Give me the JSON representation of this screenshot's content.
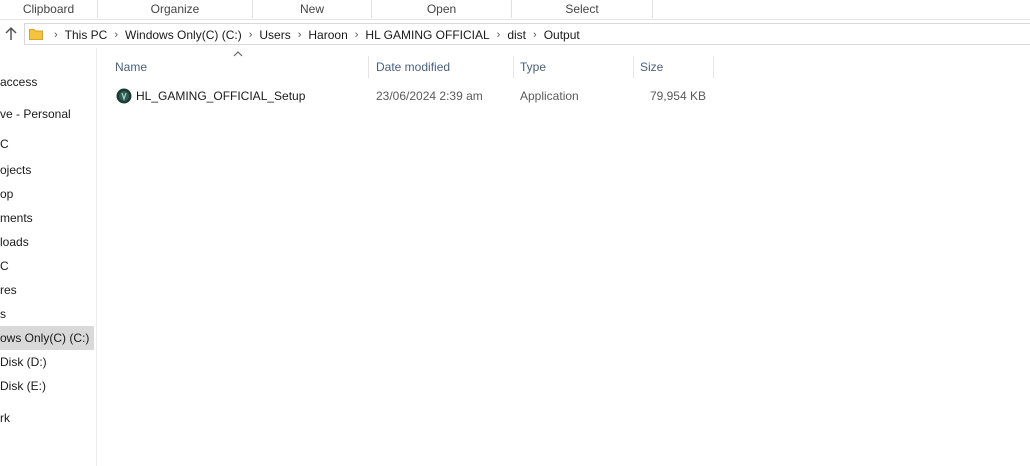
{
  "ribbon": {
    "groups": [
      "Clipboard",
      "Organize",
      "New",
      "Open",
      "Select"
    ]
  },
  "address": {
    "breadcrumbs": [
      "This PC",
      "Windows Only(C) (C:)",
      "Users",
      "Haroon",
      "HL GAMING OFFICIAL",
      "dist",
      "Output"
    ]
  },
  "nav": {
    "items": [
      {
        "label": "access"
      },
      {
        "label": "ve - Personal"
      },
      {
        "label": "C"
      },
      {
        "label": "ojects"
      },
      {
        "label": "op"
      },
      {
        "label": "ments"
      },
      {
        "label": "loads"
      },
      {
        "label": "C"
      },
      {
        "label": "res"
      },
      {
        "label": "s"
      },
      {
        "label": "ows Only(C) (C:)"
      },
      {
        "label": " Disk (D:)"
      },
      {
        "label": " Disk (E:)"
      },
      {
        "label": "rk"
      }
    ]
  },
  "columns": {
    "name": "Name",
    "date": "Date modified",
    "type": "Type",
    "size": "Size"
  },
  "files": [
    {
      "name": "HL_GAMING_OFFICIAL_Setup",
      "date": "23/06/2024 2:39 am",
      "type": "Application",
      "size": "79,954 KB",
      "icon": "app-icon"
    }
  ],
  "colors": {
    "header_text": "#4c607a",
    "selected_bg": "#d9d9d9",
    "folder": "#f0c040"
  }
}
